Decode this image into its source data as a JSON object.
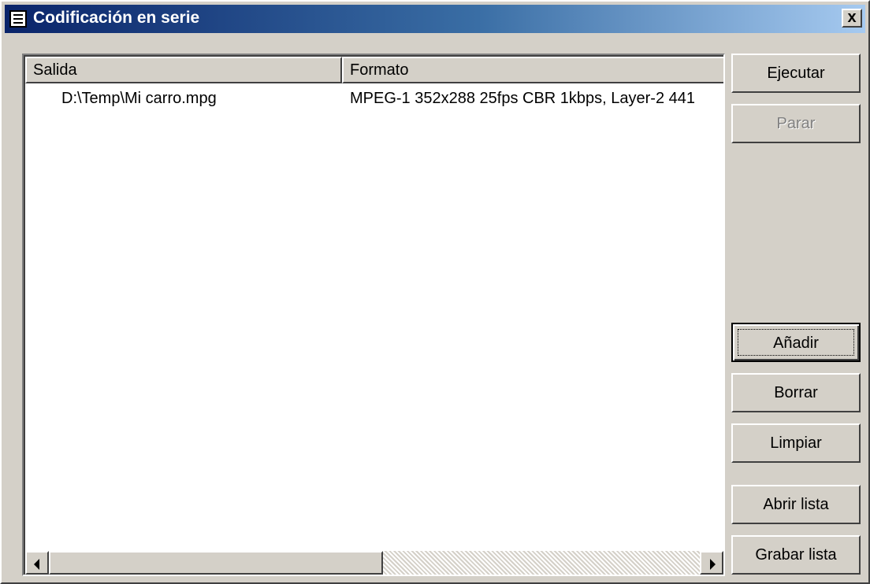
{
  "window": {
    "title": "Codificación en serie",
    "close_label": "x"
  },
  "list": {
    "columns": [
      "Salida",
      "Formato"
    ],
    "rows": [
      {
        "salida": "D:\\Temp\\Mi carro.mpg",
        "formato": "MPEG-1 352x288 25fps CBR 1kbps,  Layer-2 441"
      }
    ],
    "horizontal_scroll_position": 0
  },
  "buttons": {
    "ejecutar": "Ejecutar",
    "parar": "Parar",
    "anadir": "Añadir",
    "borrar": "Borrar",
    "limpiar": "Limpiar",
    "abrir_lista": "Abrir lista",
    "grabar_lista": "Grabar lista"
  },
  "colors": {
    "titlebar_start": "#0a246a",
    "titlebar_end": "#a6caf0",
    "face": "#d4d0c8"
  }
}
